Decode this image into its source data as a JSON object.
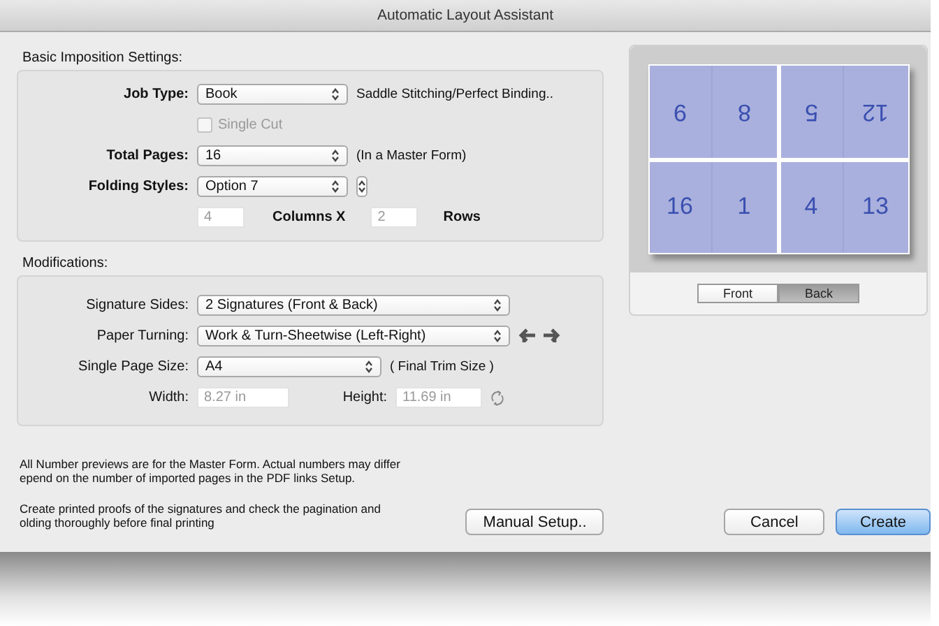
{
  "window": {
    "title": "Automatic Layout Assistant"
  },
  "basic_settings": {
    "title": "Basic Imposition Settings:",
    "job_type": {
      "label": "Job Type:",
      "value": "Book",
      "note": "Saddle Stitching/Perfect Binding.."
    },
    "single_cut": {
      "label": "Single Cut",
      "checked": false,
      "disabled": true
    },
    "total_pages": {
      "label": "Total Pages:",
      "value": "16",
      "note": "(In a Master Form)"
    },
    "folding_styles": {
      "label": "Folding Styles:",
      "value": "Option 7"
    },
    "columns": {
      "value": "4",
      "label": "Columns X",
      "disabled": true
    },
    "rows": {
      "value": "2",
      "label": "Rows",
      "disabled": true
    }
  },
  "modifications": {
    "title": "Modifications:",
    "signature_sides": {
      "label": "Signature Sides:",
      "value": "2 Signatures (Front & Back)"
    },
    "paper_turning": {
      "label": "Paper Turning:",
      "value": "Work & Turn-Sheetwise (Left-Right)"
    },
    "page_size": {
      "label": "Single Page Size:",
      "value": "A4",
      "note": "( Final Trim Size )"
    },
    "width": {
      "label": "Width:",
      "value": "8.27 in",
      "disabled": true
    },
    "height": {
      "label": "Height:",
      "value": "11.69 in",
      "disabled": true
    }
  },
  "preview": {
    "pages": [
      {
        "number": "9",
        "rotated": true
      },
      {
        "number": "8",
        "rotated": true
      },
      {
        "number": "5",
        "rotated": true
      },
      {
        "number": "12",
        "rotated": true
      },
      {
        "number": "16",
        "rotated": false
      },
      {
        "number": "1",
        "rotated": false
      },
      {
        "number": "4",
        "rotated": false
      },
      {
        "number": "13",
        "rotated": false
      }
    ],
    "sides": [
      {
        "label": "Front",
        "selected": false
      },
      {
        "label": "Back",
        "selected": true
      }
    ]
  },
  "notes": [
    {
      "lines": [
        "All Number previews are for the Master Form. Actual numbers may differ",
        "epend on the number of imported pages in the PDF links Setup."
      ]
    },
    {
      "lines": [
        "Create printed proofs of the signatures and check the pagination and",
        "olding thoroughly before final printing"
      ]
    }
  ],
  "buttons": [
    {
      "label": "Manual Setup..",
      "kind": "plain"
    },
    {
      "label": "Cancel",
      "kind": "plain"
    },
    {
      "label": "Create",
      "kind": "default"
    }
  ]
}
